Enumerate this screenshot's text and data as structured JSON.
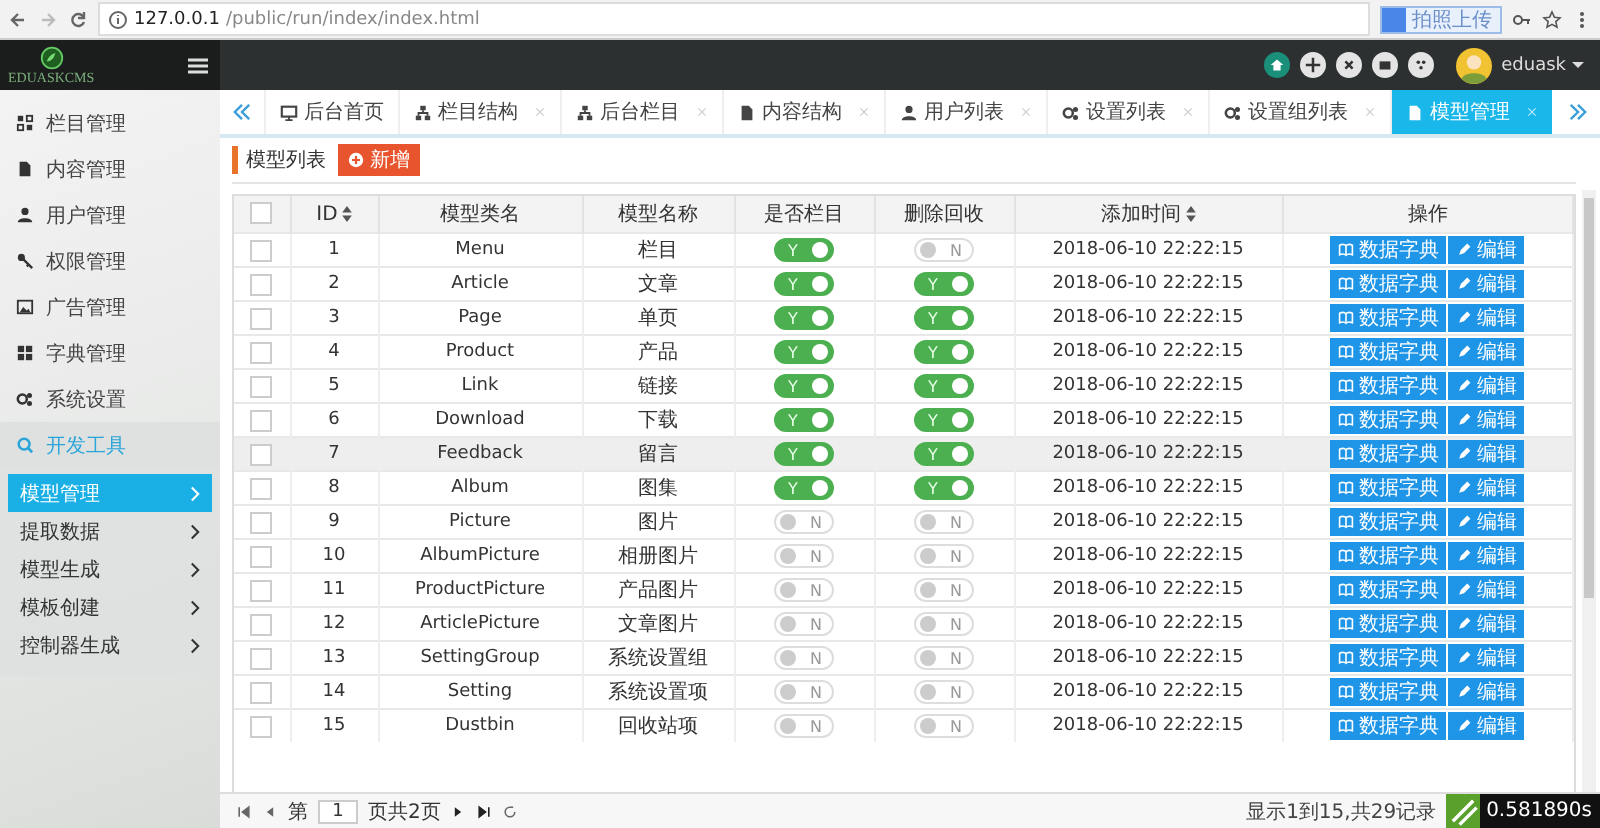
{
  "browser": {
    "url_host": "127.0.0.1",
    "url_path": "/public/run/index/index.html",
    "extension_label": "拍照上传"
  },
  "header": {
    "brand": "EDUASKCMS",
    "user": "eduask"
  },
  "sidebar": {
    "items": [
      {
        "label": "栏目管理",
        "expanded": false
      },
      {
        "label": "内容管理",
        "expanded": false
      },
      {
        "label": "用户管理",
        "expanded": false
      },
      {
        "label": "权限管理",
        "expanded": false
      },
      {
        "label": "广告管理",
        "expanded": false
      },
      {
        "label": "字典管理",
        "expanded": false
      },
      {
        "label": "系统设置",
        "expanded": false
      },
      {
        "label": "开发工具",
        "expanded": true,
        "children": [
          {
            "label": "模型管理",
            "selected": true
          },
          {
            "label": "提取数据",
            "selected": false
          },
          {
            "label": "模型生成",
            "selected": false
          },
          {
            "label": "模板创建",
            "selected": false
          },
          {
            "label": "控制器生成",
            "selected": false
          }
        ]
      }
    ]
  },
  "tabs": [
    {
      "label": "后台首页",
      "closable": false,
      "selected": false
    },
    {
      "label": "栏目结构",
      "closable": true,
      "selected": false
    },
    {
      "label": "后台栏目",
      "closable": true,
      "selected": false
    },
    {
      "label": "内容结构",
      "closable": true,
      "selected": false
    },
    {
      "label": "用户列表",
      "closable": true,
      "selected": false
    },
    {
      "label": "设置列表",
      "closable": true,
      "selected": false
    },
    {
      "label": "设置组列表",
      "closable": true,
      "selected": false
    },
    {
      "label": "模型管理",
      "closable": true,
      "selected": true
    }
  ],
  "toolbar": {
    "title": "模型列表",
    "add_button": "新增"
  },
  "table": {
    "select_all": {
      "checked": false
    },
    "columns": [
      {
        "label": "ID",
        "sortable": true
      },
      {
        "label": "模型类名",
        "sortable": false
      },
      {
        "label": "模型名称",
        "sortable": false
      },
      {
        "label": "是否栏目",
        "sortable": false
      },
      {
        "label": "删除回收",
        "sortable": false
      },
      {
        "label": "添加时间",
        "sortable": true
      },
      {
        "label": "操作",
        "sortable": false
      }
    ],
    "rows": [
      {
        "checked": false,
        "id": "1",
        "class_name": "Menu",
        "name": "栏目",
        "is_column": {
          "on": true,
          "label": "Y"
        },
        "recycle": {
          "on": false,
          "label": "N"
        },
        "added": "2018-06-10 22:22:15",
        "actions": [
          "数据字典",
          "编辑"
        ],
        "highlighted": false
      },
      {
        "checked": false,
        "id": "2",
        "class_name": "Article",
        "name": "文章",
        "is_column": {
          "on": true,
          "label": "Y"
        },
        "recycle": {
          "on": true,
          "label": "Y"
        },
        "added": "2018-06-10 22:22:15",
        "actions": [
          "数据字典",
          "编辑"
        ],
        "highlighted": false
      },
      {
        "checked": false,
        "id": "3",
        "class_name": "Page",
        "name": "单页",
        "is_column": {
          "on": true,
          "label": "Y"
        },
        "recycle": {
          "on": true,
          "label": "Y"
        },
        "added": "2018-06-10 22:22:15",
        "actions": [
          "数据字典",
          "编辑"
        ],
        "highlighted": false
      },
      {
        "checked": false,
        "id": "4",
        "class_name": "Product",
        "name": "产品",
        "is_column": {
          "on": true,
          "label": "Y"
        },
        "recycle": {
          "on": true,
          "label": "Y"
        },
        "added": "2018-06-10 22:22:15",
        "actions": [
          "数据字典",
          "编辑"
        ],
        "highlighted": false
      },
      {
        "checked": false,
        "id": "5",
        "class_name": "Link",
        "name": "链接",
        "is_column": {
          "on": true,
          "label": "Y"
        },
        "recycle": {
          "on": true,
          "label": "Y"
        },
        "added": "2018-06-10 22:22:15",
        "actions": [
          "数据字典",
          "编辑"
        ],
        "highlighted": false
      },
      {
        "checked": false,
        "id": "6",
        "class_name": "Download",
        "name": "下载",
        "is_column": {
          "on": true,
          "label": "Y"
        },
        "recycle": {
          "on": true,
          "label": "Y"
        },
        "added": "2018-06-10 22:22:15",
        "actions": [
          "数据字典",
          "编辑"
        ],
        "highlighted": false
      },
      {
        "checked": false,
        "id": "7",
        "class_name": "Feedback",
        "name": "留言",
        "is_column": {
          "on": true,
          "label": "Y"
        },
        "recycle": {
          "on": true,
          "label": "Y"
        },
        "added": "2018-06-10 22:22:15",
        "actions": [
          "数据字典",
          "编辑"
        ],
        "highlighted": true
      },
      {
        "checked": false,
        "id": "8",
        "class_name": "Album",
        "name": "图集",
        "is_column": {
          "on": true,
          "label": "Y"
        },
        "recycle": {
          "on": true,
          "label": "Y"
        },
        "added": "2018-06-10 22:22:15",
        "actions": [
          "数据字典",
          "编辑"
        ],
        "highlighted": false
      },
      {
        "checked": false,
        "id": "9",
        "class_name": "Picture",
        "name": "图片",
        "is_column": {
          "on": false,
          "label": "N"
        },
        "recycle": {
          "on": false,
          "label": "N"
        },
        "added": "2018-06-10 22:22:15",
        "actions": [
          "数据字典",
          "编辑"
        ],
        "highlighted": false
      },
      {
        "checked": false,
        "id": "10",
        "class_name": "AlbumPicture",
        "name": "相册图片",
        "is_column": {
          "on": false,
          "label": "N"
        },
        "recycle": {
          "on": false,
          "label": "N"
        },
        "added": "2018-06-10 22:22:15",
        "actions": [
          "数据字典",
          "编辑"
        ],
        "highlighted": false
      },
      {
        "checked": false,
        "id": "11",
        "class_name": "ProductPicture",
        "name": "产品图片",
        "is_column": {
          "on": false,
          "label": "N"
        },
        "recycle": {
          "on": false,
          "label": "N"
        },
        "added": "2018-06-10 22:22:15",
        "actions": [
          "数据字典",
          "编辑"
        ],
        "highlighted": false
      },
      {
        "checked": false,
        "id": "12",
        "class_name": "ArticlePicture",
        "name": "文章图片",
        "is_column": {
          "on": false,
          "label": "N"
        },
        "recycle": {
          "on": false,
          "label": "N"
        },
        "added": "2018-06-10 22:22:15",
        "actions": [
          "数据字典",
          "编辑"
        ],
        "highlighted": false
      },
      {
        "checked": false,
        "id": "13",
        "class_name": "SettingGroup",
        "name": "系统设置组",
        "is_column": {
          "on": false,
          "label": "N"
        },
        "recycle": {
          "on": false,
          "label": "N"
        },
        "added": "2018-06-10 22:22:15",
        "actions": [
          "数据字典",
          "编辑"
        ],
        "highlighted": false
      },
      {
        "checked": false,
        "id": "14",
        "class_name": "Setting",
        "name": "系统设置项",
        "is_column": {
          "on": false,
          "label": "N"
        },
        "recycle": {
          "on": false,
          "label": "N"
        },
        "added": "2018-06-10 22:22:15",
        "actions": [
          "数据字典",
          "编辑"
        ],
        "highlighted": false
      },
      {
        "checked": false,
        "id": "15",
        "class_name": "Dustbin",
        "name": "回收站项",
        "is_column": {
          "on": false,
          "label": "N"
        },
        "recycle": {
          "on": false,
          "label": "N"
        },
        "added": "2018-06-10 22:22:15",
        "actions": [
          "数据字典",
          "编辑"
        ],
        "highlighted": false
      }
    ]
  },
  "pagination": {
    "page_prefix": "第",
    "page": "1",
    "page_suffix": "页共2页",
    "summary": "显示1到15,共29记录",
    "timing": "0.581890s"
  }
}
